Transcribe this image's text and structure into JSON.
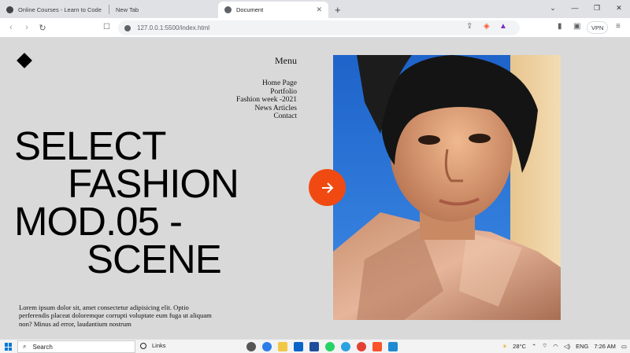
{
  "browser": {
    "tabs": [
      {
        "label": "Online Courses - Learn to Code Any",
        "icon": "site-icon"
      },
      {
        "label": "New Tab",
        "icon": ""
      },
      {
        "label": "Document",
        "icon": "globe-icon",
        "active": true
      }
    ],
    "new_tab": "+",
    "url": "127.0.0.1:5500/index.html",
    "vpn_label": "VPN"
  },
  "site": {
    "menu_title": "Menu",
    "nav": [
      "Home Page",
      "Portfolio",
      "Fashion week -2021",
      "News Articles",
      "Contact"
    ],
    "headline": [
      "SELECT",
      "FASHION",
      "MOD.05 -",
      "SCENE"
    ],
    "body": "Lorem ipsum dolor sit, amet consectetur adipisicing elit. Optio perferendis placeat doloremque corrupti voluptate eum fuga ut aliquam non? Minus ad error, laudantium nostrum",
    "accent_color": "#f04a12"
  },
  "taskbar": {
    "search_label": "Search",
    "links_label": "Links",
    "weather": "28°C",
    "language": "ENG",
    "time": "7:26 AM"
  }
}
